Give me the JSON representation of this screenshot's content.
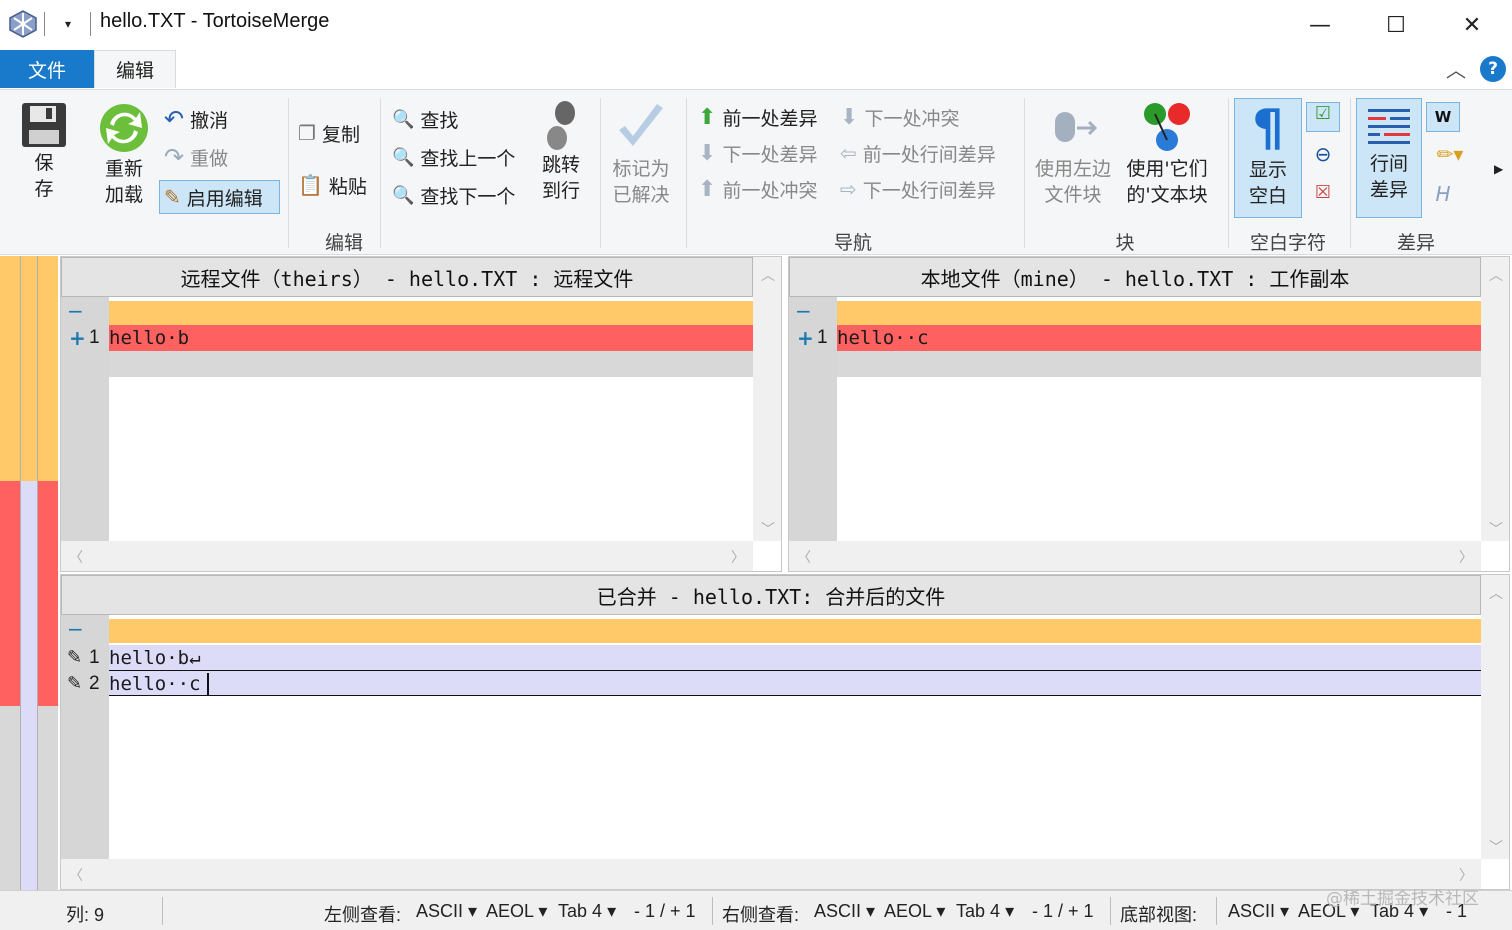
{
  "window": {
    "title": "hello.TXT - TortoiseMerge",
    "controls": [
      "—",
      "☐",
      "✕"
    ]
  },
  "ribbon_tabs": [
    {
      "label": "文件",
      "active": false
    },
    {
      "label": "编辑",
      "active": true
    }
  ],
  "ribbon": {
    "save": {
      "line1": "保",
      "line2": "存"
    },
    "reload": {
      "line1": "重新",
      "line2": "加载"
    },
    "undo": "撤消",
    "redo": "重做",
    "enable_edit": "启用编辑",
    "copy": "复制",
    "paste": "粘贴",
    "find": "查找",
    "find_prev": "查找上一个",
    "find_next": "查找下一个",
    "goto": {
      "line1": "跳转",
      "line2": "到行"
    },
    "mark_resolved": {
      "line1": "标记为",
      "line2": "已解决"
    },
    "prev_diff": "前一处差异",
    "next_diff": "下一处差异",
    "prev_conflict": "前一处冲突",
    "next_conflict": "下一处冲突",
    "prev_inline": "前一处行间差异",
    "next_inline": "下一处行间差异",
    "use_left": {
      "line1": "使用左边",
      "line2": "文件块"
    },
    "use_their": {
      "line1": "使用'它们",
      "line2": "的'文本块"
    },
    "show_whitespace": {
      "line1": "显示",
      "line2": "空白"
    },
    "inline_diff": {
      "line1": "行间",
      "line2": "差异"
    },
    "groups": {
      "edit": "编辑",
      "nav": "导航",
      "block": "块",
      "whitespace": "空白字符",
      "diff": "差异"
    }
  },
  "panes": {
    "left": {
      "header": "远程文件（theirs） - hello.TXT : 远程文件",
      "lines": [
        {
          "num": "1",
          "marker": "+",
          "text": "hello·b"
        }
      ]
    },
    "right": {
      "header": "本地文件（mine） - hello.TXT : 工作副本",
      "lines": [
        {
          "num": "1",
          "marker": "+",
          "text": "hello··c"
        }
      ]
    },
    "bottom": {
      "header": "已合并 - hello.TXT: 合并后的文件",
      "lines": [
        {
          "num": "1",
          "marker": "✎",
          "text": "hello·b↵"
        },
        {
          "num": "2",
          "marker": "✎",
          "text": "hello··c"
        }
      ]
    }
  },
  "statusbar": {
    "column": "列: 9",
    "left_view_label": "左侧查看:",
    "right_view_label": "右侧查看:",
    "bottom_view_label": "底部视图:",
    "encoding": "ASCII",
    "eol": "AEOL",
    "tab": "Tab 4",
    "left_counts": "- 1 / + 1",
    "right_counts": "- 1 / + 1",
    "bottom_counts": "- 1"
  },
  "watermark": "@稀土掘金技术社区",
  "colors": {
    "accent": "#1979ca",
    "removed_line": "#ff6160",
    "empty_line": "#ffc868",
    "edited_line": "#dcdcf8"
  }
}
